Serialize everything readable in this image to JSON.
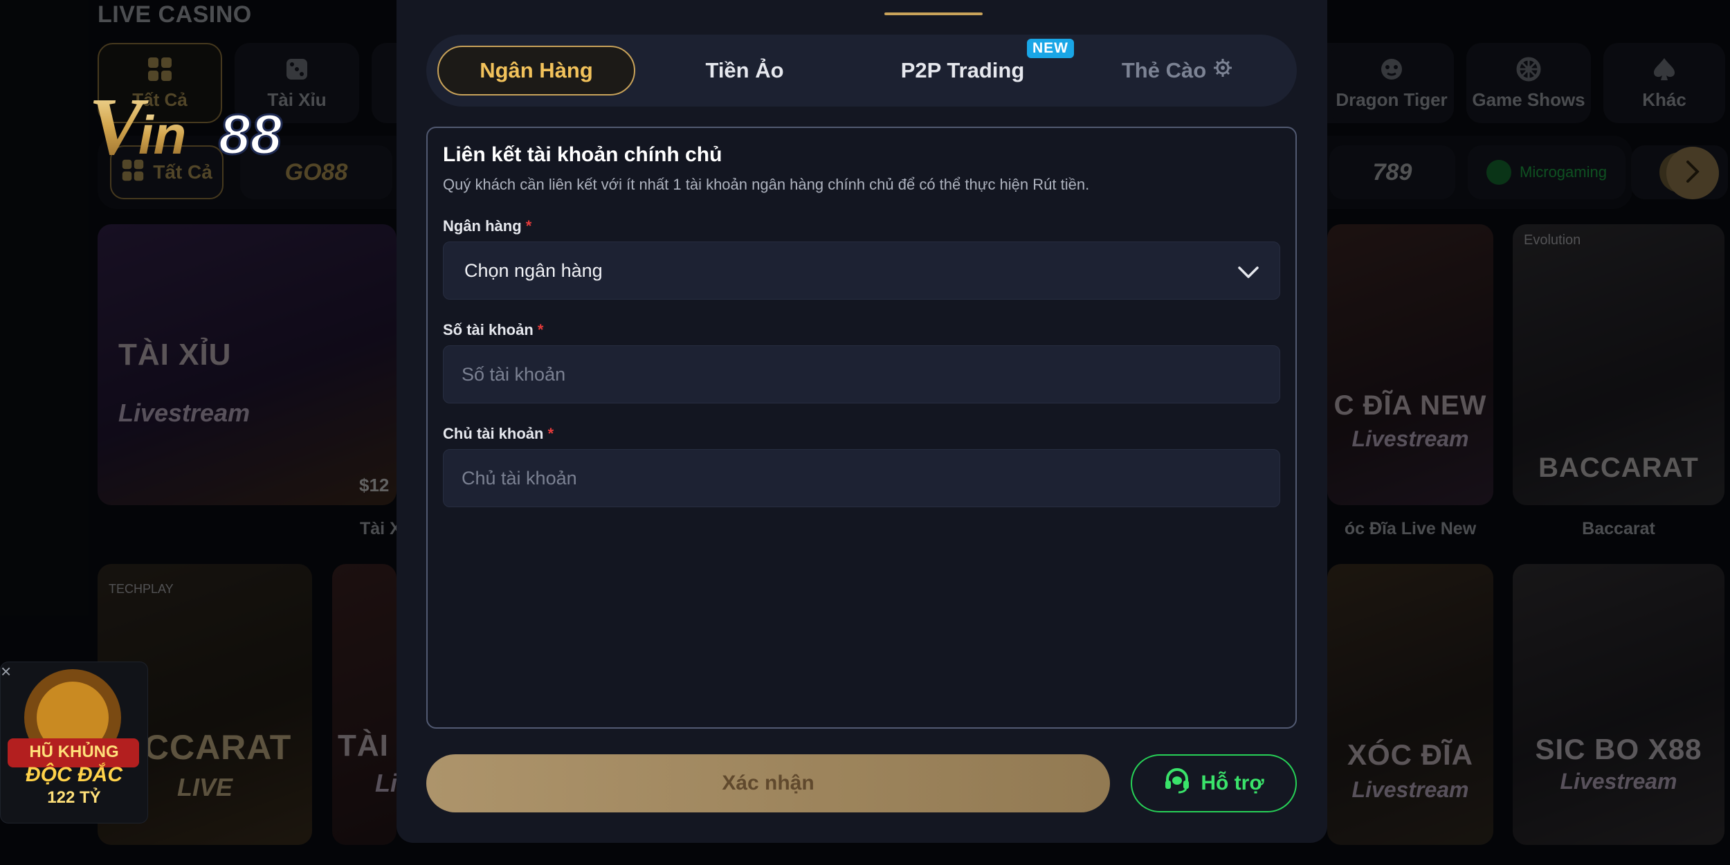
{
  "background": {
    "section_title": "LIVE CASINO",
    "category_tabs": [
      {
        "label": "Tất Cả",
        "icon": "grid-icon",
        "active": true
      },
      {
        "label": "Tài Xỉu",
        "icon": "dice-icon",
        "active": false
      },
      {
        "label": "Dragon Tiger",
        "icon": "tiger-icon",
        "active": false
      },
      {
        "label": "Game Shows",
        "icon": "wheel-icon",
        "active": false
      },
      {
        "label": "Khác",
        "icon": "spade-icon",
        "active": false
      }
    ],
    "provider_chips": [
      {
        "label": "Tất Cả",
        "icon": "grid-icon",
        "active": true
      },
      {
        "label": "GO88",
        "icon": "go88-logo"
      },
      {
        "label": "789",
        "icon": "789club-logo"
      },
      {
        "label": "Microgaming",
        "icon": "microgaming-logo"
      },
      {
        "label": "",
        "icon": "dice-logo"
      }
    ],
    "games_row1": [
      {
        "art_title": "TÀI XỈU",
        "art_sub": "Livestream",
        "amount": "$12",
        "name": "Tài X"
      },
      {
        "art_title": "C ĐĨA NEW",
        "art_sub": "Livestream",
        "name": "óc Đĩa Live New"
      },
      {
        "art_title": "BACCARAT",
        "art_sub": "",
        "provider": "Evolution",
        "name": "Baccarat"
      }
    ],
    "games_row2": [
      {
        "art_title": "ACCARAT",
        "art_sub": "LIVE",
        "provider": "TECHPLAY"
      },
      {
        "art_title": "TÀI",
        "art_sub": "Li"
      },
      {
        "art_title": "XÓC ĐĨA",
        "art_sub": "Livestream"
      },
      {
        "art_title": "SIC BO X88",
        "art_sub": "Livestream"
      }
    ],
    "logo": "VIN88",
    "jackpot": {
      "line1": "HŨ KHỦNG",
      "line2": "ĐỘC ĐẮC",
      "line3": "122 TỶ"
    }
  },
  "modal": {
    "tabs": [
      {
        "label": "Ngân Hàng",
        "state": "active"
      },
      {
        "label": "Tiền Ảo",
        "state": "normal"
      },
      {
        "label": "P2P Trading",
        "state": "normal",
        "badge": "NEW"
      },
      {
        "label": "Thẻ Cào",
        "state": "disabled",
        "icon": "gear-icon"
      }
    ],
    "form": {
      "heading": "Liên kết tài khoản chính chủ",
      "description": "Quý khách cần liên kết với ít nhất 1 tài khoản ngân hàng chính chủ để có thể thực hiện Rút tiền.",
      "bank_label": "Ngân hàng",
      "bank_value": "Chọn ngân hàng",
      "account_number_label": "Số tài khoản",
      "account_number_placeholder": "Số tài khoản",
      "account_holder_label": "Chủ tài khoản",
      "account_holder_placeholder": "Chủ tài khoản",
      "required_mark": "*"
    },
    "confirm_label": "Xác nhận",
    "support_label": "Hỗ trợ"
  },
  "colors": {
    "accent_gold": "#c9a35a",
    "support_green": "#27d157",
    "required_red": "#e53b3b",
    "new_badge_blue": "#19a6e6"
  }
}
